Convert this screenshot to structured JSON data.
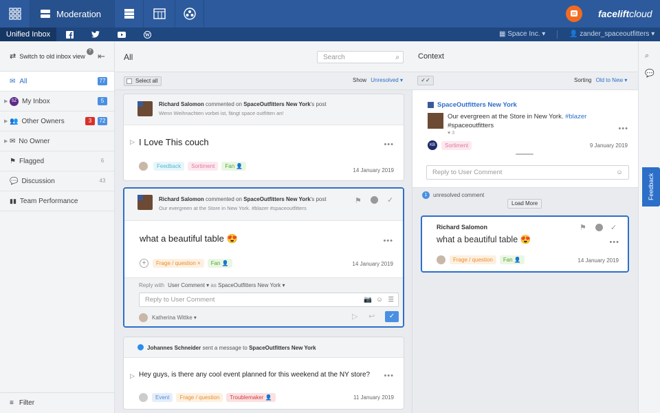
{
  "topbar": {
    "title": "Moderation",
    "brand_bold": "facelift",
    "brand_light": "cloud"
  },
  "subbar": {
    "active_tab": "Unified Inbox",
    "workspace": "Space Inc.",
    "user": "zander_spaceoutfitters"
  },
  "sidebar": {
    "switch_label": "Switch to old inbox view",
    "switch_badge": "?",
    "items": [
      {
        "label": "All",
        "count": "77"
      },
      {
        "label": "My Inbox",
        "count": "5",
        "avatar": "SZ"
      },
      {
        "label": "Other Owners",
        "count_red": "3",
        "count": "72"
      },
      {
        "label": "No Owner",
        "count": ""
      },
      {
        "label": "Flagged",
        "count": "6"
      },
      {
        "label": "Discussion",
        "count": "43"
      },
      {
        "label": "Team Performance",
        "count": ""
      }
    ],
    "filter": "Filter"
  },
  "middle": {
    "title": "All",
    "search_placeholder": "Search",
    "select_all": "Select all",
    "show_label": "Show",
    "show_value": "Unresolved",
    "cards": [
      {
        "author": "Richard Salomon",
        "verb": "commented on",
        "page": "SpaceOutfitters New York",
        "suffix": "'s post",
        "preview": "Wenn Weihnachten vorbei ist, fängt space outfitten an!",
        "message": "I Love This couch",
        "tags": [
          "Feedback",
          "Sortiment",
          "Fan"
        ],
        "date": "14 January 2019"
      },
      {
        "author": "Richard Salomon",
        "verb": "commented on",
        "page": "SpaceOutfitters New York",
        "suffix": "'s post",
        "preview": "Our evergreen at the Store in New York. #blazer #spaceoutfitters",
        "message": "what a beautiful table 😍",
        "tags": [
          "Frage / question",
          "Fan"
        ],
        "date": "14 January 2019",
        "reply_with": "Reply with",
        "reply_type": "User Comment",
        "reply_as": "as",
        "reply_page": "SpaceOutfitters New York",
        "reply_placeholder": "Reply to User Comment",
        "agent": "Katherina Wittke"
      },
      {
        "author": "Johannes Schneider",
        "verb": "sent a message to",
        "page": "SpaceOutfitters New York",
        "suffix": "",
        "message": "Hey guys, is there any cool event planned for this weekend at the NY store?",
        "tags": [
          "Event",
          "Frage / question",
          "Troublemaker"
        ],
        "date": "11 January 2019"
      }
    ]
  },
  "context": {
    "title": "Context",
    "sorting_label": "Sorting",
    "sorting_value": "Old to New",
    "page_name": "SpaceOutfitters New York",
    "post_text": "Our evergreen at the Store in New York.",
    "post_hashtag": "#blazer",
    "post_hashtag2": "#spaceoutfitters",
    "likes": "3",
    "author_initials": "KB",
    "post_tag": "Sortiment",
    "post_date": "9 January 2019",
    "reply_placeholder": "Reply to User Comment",
    "unresolved_count": "1",
    "unresolved_label": "unresolved comment",
    "load_more": "Load More",
    "comment": {
      "author": "Richard Salomon",
      "message": "what a beautiful table 😍",
      "tags": [
        "Frage / question",
        "Fan"
      ],
      "date": "14 January 2019"
    }
  },
  "feedback_tab": "Feedback",
  "colors": {
    "primary": "#2c5a9c",
    "accent": "#2c6fc9",
    "brand_orange": "#f26b21"
  }
}
